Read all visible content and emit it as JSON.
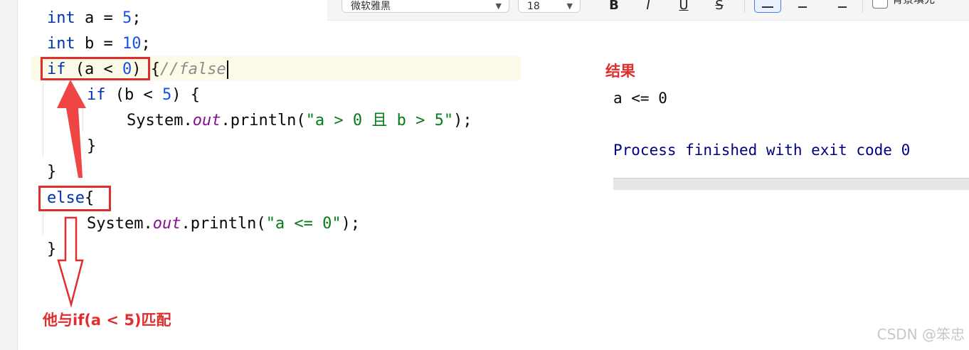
{
  "toolbar": {
    "font_family": "微软雅黑",
    "font_size": "18",
    "bold": "B",
    "italic": "I",
    "underline": "U",
    "strikethrough": "S",
    "background_fill_label": "背景填充"
  },
  "code": {
    "line1": {
      "kw": "int",
      "rest": " a = ",
      "num": "5",
      "end": ";"
    },
    "line2": {
      "kw": "int",
      "rest": " b = ",
      "num": "10",
      "end": ";"
    },
    "line3": {
      "kw": "if",
      "p1": " (a < ",
      "num": "0",
      "p2": ") {",
      "comment": "//false"
    },
    "line4": {
      "kw": "if",
      "p1": " (b < ",
      "num": "5",
      "p2": ") {"
    },
    "line5": {
      "a": "System.",
      "field": "out",
      "b": ".println(",
      "str": "\"a > 0 且 b > 5\"",
      "c": ");"
    },
    "line6": "}",
    "line7": "}",
    "line8": {
      "kw": "else",
      "end": "{"
    },
    "line9": {
      "a": "System.",
      "field": "out",
      "b": ".println(",
      "str": "\"a <= 0\"",
      "c": ");"
    },
    "line10": "}"
  },
  "annotations": {
    "result_label": "结果",
    "match_note": "他与if(a < 5)匹配"
  },
  "console": {
    "output_line": "a <= 0",
    "process_line": "Process finished with exit code 0"
  },
  "watermark": "CSDN @笨忠",
  "colors": {
    "keyword": "#0033b3",
    "number": "#1750eb",
    "string": "#067d17",
    "field": "#871094",
    "comment": "#8c8c8c",
    "annotation_red": "#e02d2d",
    "console_text": "#000080"
  }
}
